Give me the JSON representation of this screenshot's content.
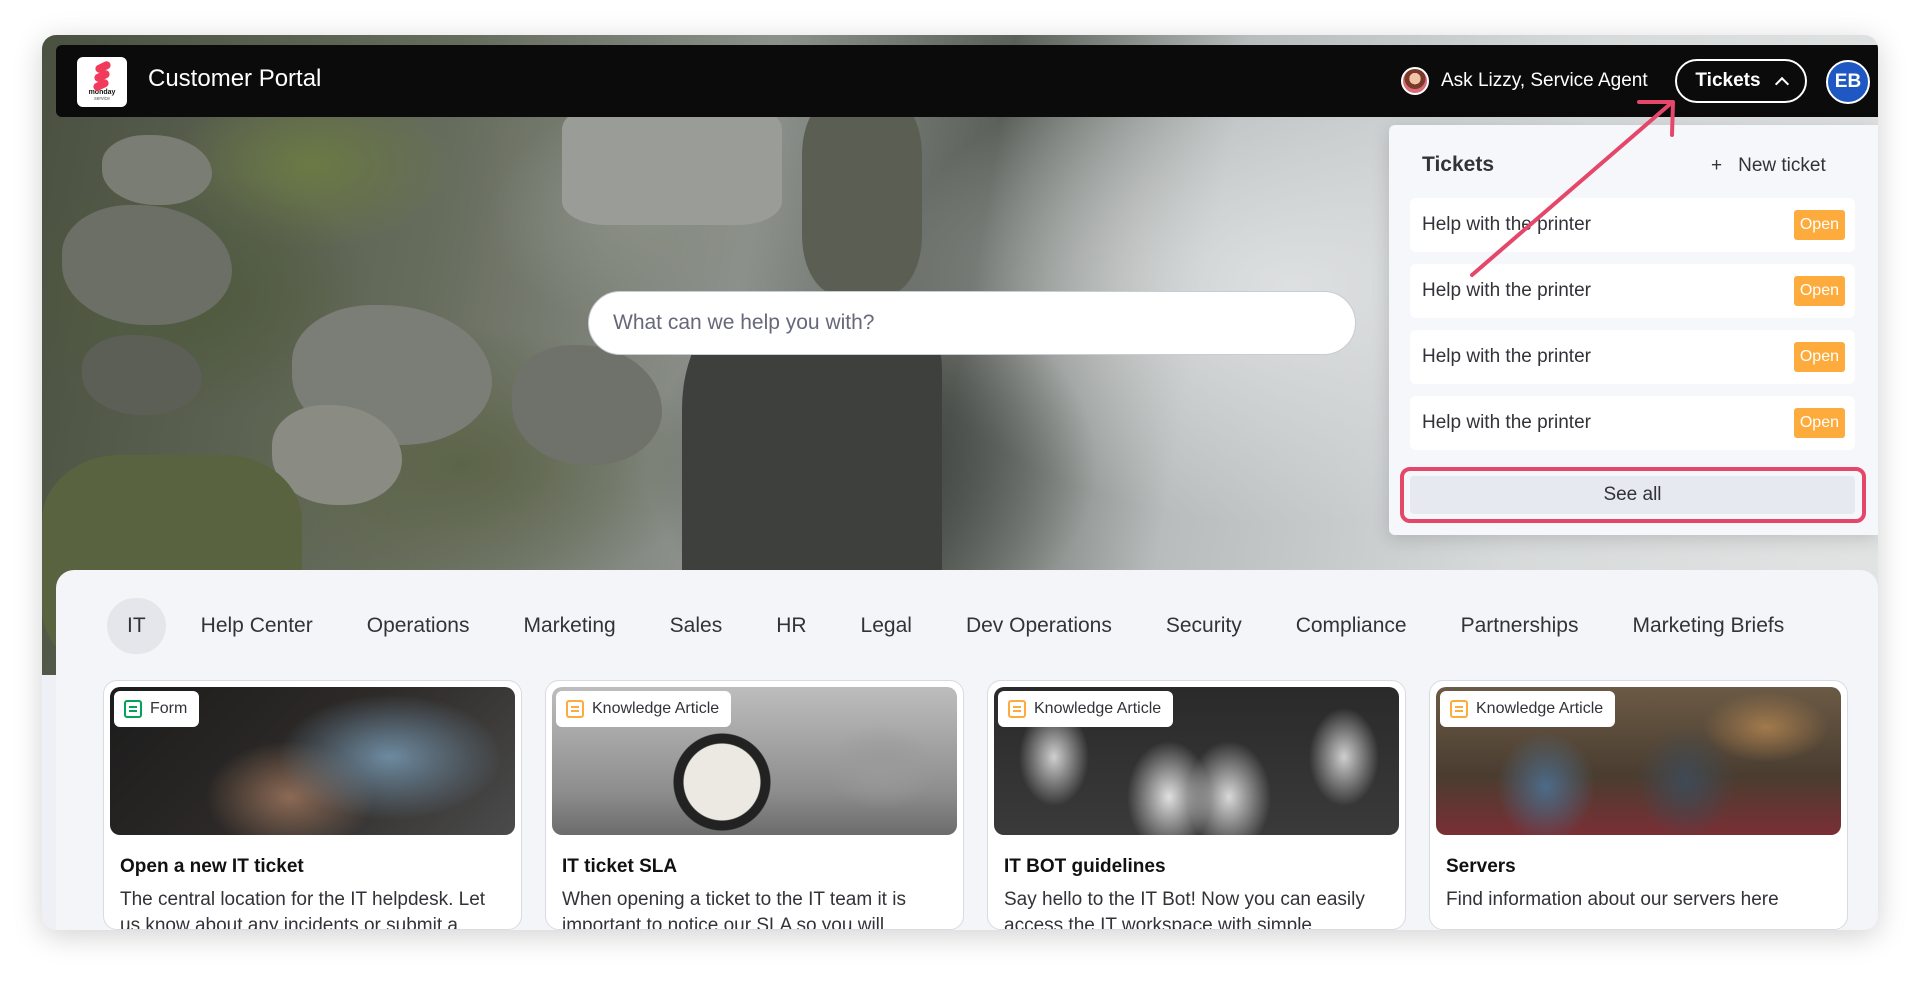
{
  "header": {
    "logo_text": "monday",
    "logo_sub": "service",
    "title": "Customer Portal",
    "ask_label": "Ask Lizzy, Service Agent",
    "tickets_label": "Tickets",
    "avatar_initials": "EB"
  },
  "search": {
    "placeholder": "What can we help you with?"
  },
  "tickets_dropdown": {
    "title": "Tickets",
    "new_ticket_label": "New ticket",
    "items": [
      {
        "label": "Help with the printer",
        "status": "Open"
      },
      {
        "label": "Help with the printer",
        "status": "Open"
      },
      {
        "label": "Help with the printer",
        "status": "Open"
      },
      {
        "label": "Help with the printer",
        "status": "Open"
      }
    ],
    "see_all_label": "See all"
  },
  "tabs": [
    "IT",
    "Help Center",
    "Operations",
    "Marketing",
    "Sales",
    "HR",
    "Legal",
    "Dev Operations",
    "Security",
    "Compliance",
    "Partnerships",
    "Marketing Briefs"
  ],
  "cards": [
    {
      "tag": "Form",
      "title": "Open a new IT ticket",
      "description": "The central location for the IT helpdesk. Let us know about any incidents or submit a"
    },
    {
      "tag": "Knowledge Article",
      "title": "IT ticket SLA",
      "description": "When opening a ticket to the IT team it is important to notice our SLA so you will"
    },
    {
      "tag": "Knowledge Article",
      "title": "IT BOT guidelines",
      "description": "Say hello to the IT Bot! Now you can easily access the IT workspace with simple"
    },
    {
      "tag": "Knowledge Article",
      "title": "Servers",
      "description": "Find information about our servers here"
    }
  ],
  "colors": {
    "brand": "#f23a5a",
    "status_open": "#fdab3d",
    "avatar": "#1f57c3",
    "annotation": "#e4476a",
    "form_icon": "#00a35a",
    "article_icon": "#fdab3d"
  }
}
